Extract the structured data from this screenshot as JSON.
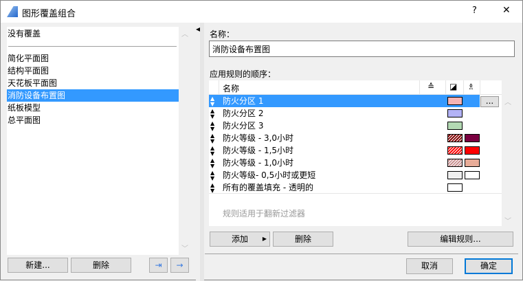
{
  "window": {
    "title": "图形覆盖组合",
    "help": "?",
    "close": "✕"
  },
  "left": {
    "none_item": "没有覆盖",
    "items": [
      "简化平面图",
      "结构平面图",
      "天花板平面图",
      "消防设备布置图",
      "纸板模型",
      "总平面图"
    ],
    "selected": 3,
    "new_button": "新建...",
    "delete_button": "删除"
  },
  "right": {
    "name_label": "名称：",
    "name_value": "消防设备布置图",
    "rules_label": "应用规则的顺序：",
    "col_name": "名称",
    "rules": [
      {
        "name": "防火分区 1",
        "fill": "#e00000",
        "pattern": "dots",
        "bg": null
      },
      {
        "name": "防火分区 2",
        "fill": "#0000e0",
        "pattern": "dots",
        "bg": null
      },
      {
        "name": "防火分区 3",
        "fill": "#008000",
        "pattern": "dots",
        "bg": null
      },
      {
        "name": "防火等级 - 3,0小时",
        "fill": "#800000",
        "pattern": "hatch",
        "bg": "#7a0040"
      },
      {
        "name": "防火等级 - 1,5小时",
        "fill": "#ff0000",
        "pattern": "hatch",
        "bg": "#ff0000"
      },
      {
        "name": "防火等级 - 1,0小时",
        "fill": "#c89090",
        "pattern": "hatch",
        "bg": "#e8ac98"
      },
      {
        "name": "防火等级- 0,5小时或更短",
        "fill": "#f0f0f0",
        "pattern": "solid",
        "bg": "#ffffff"
      },
      {
        "name": "所有的覆盖填充 - 透明的",
        "fill": "#ffffff",
        "pattern": "solid",
        "bg": null
      }
    ],
    "more_button": "...",
    "renovation_note": "规则适用于翻新过滤器",
    "add_button": "添加",
    "delete_button": "删除",
    "edit_rules_button": "编辑规则...",
    "cancel_button": "取消",
    "ok_button": "确定"
  }
}
